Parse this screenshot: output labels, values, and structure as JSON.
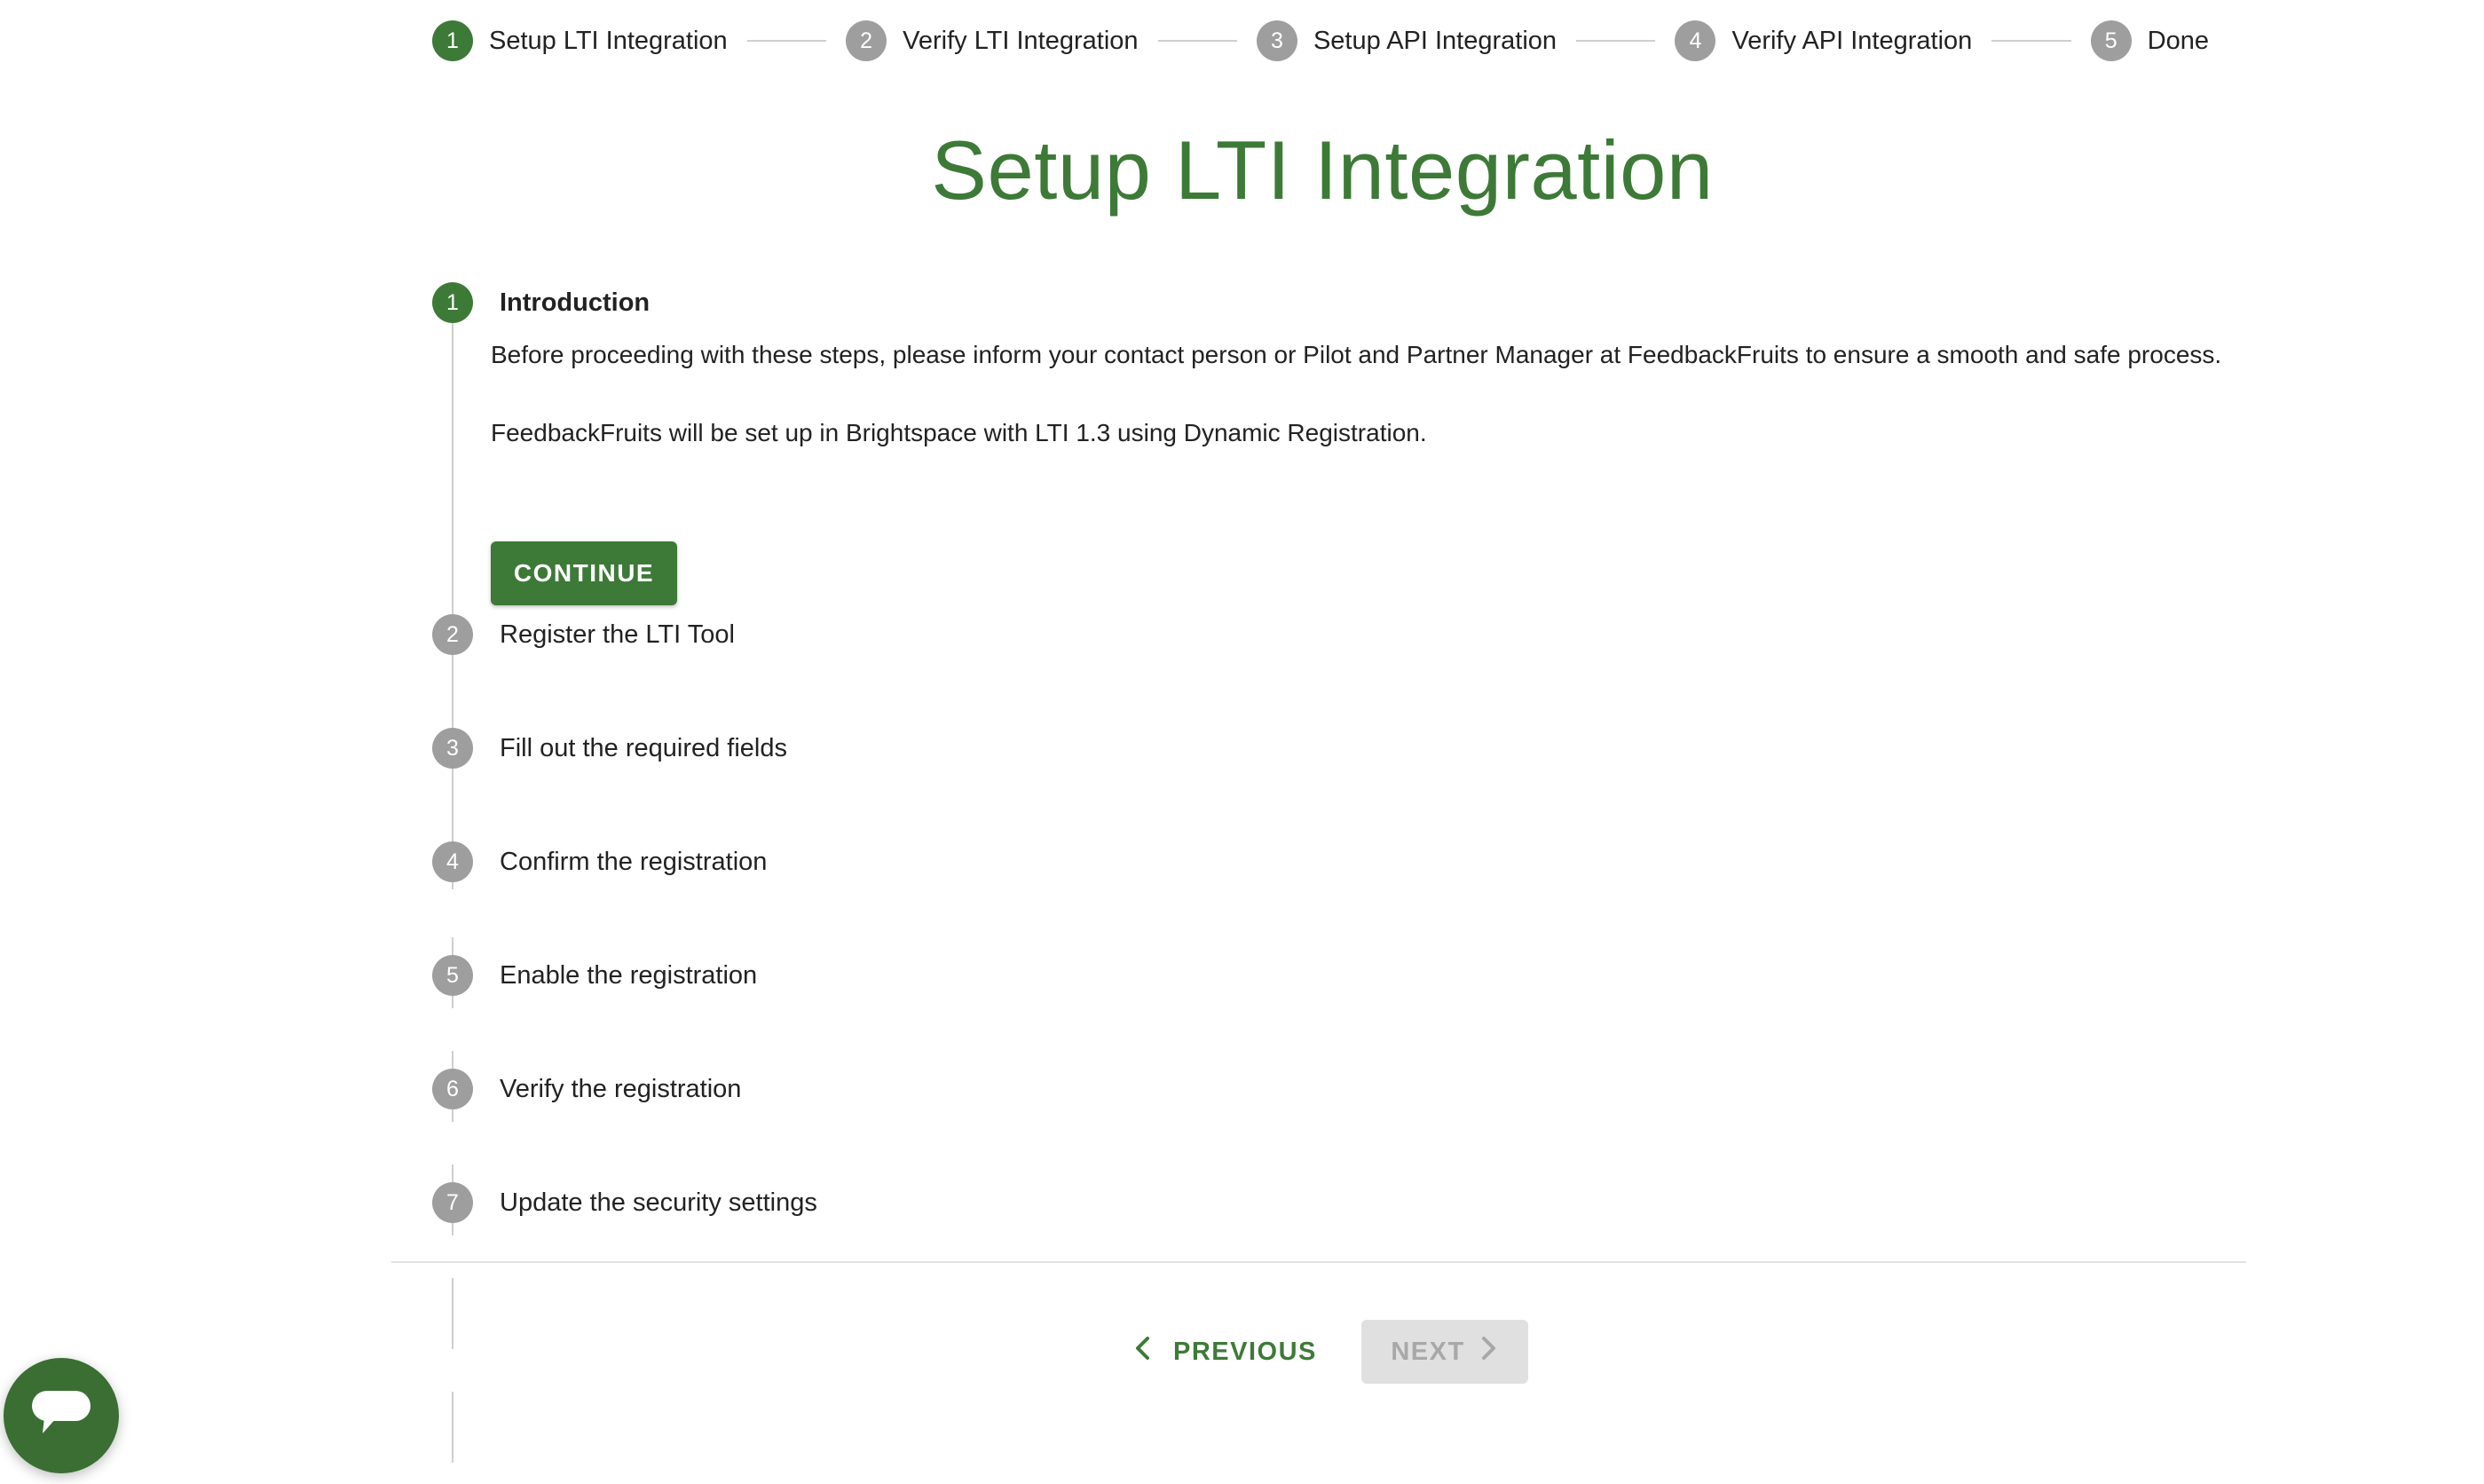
{
  "top_stepper": [
    {
      "num": "1",
      "label": "Setup LTI Integration",
      "active": true
    },
    {
      "num": "2",
      "label": "Verify LTI Integration",
      "active": false
    },
    {
      "num": "3",
      "label": "Setup API Integration",
      "active": false
    },
    {
      "num": "4",
      "label": "Verify API Integration",
      "active": false
    },
    {
      "num": "5",
      "label": "Done",
      "active": false
    }
  ],
  "page_title": "Setup LTI Integration",
  "steps": [
    {
      "num": "1",
      "label": "Introduction",
      "active": true
    },
    {
      "num": "2",
      "label": "Register the LTI Tool",
      "active": false
    },
    {
      "num": "3",
      "label": "Fill out the required fields",
      "active": false
    },
    {
      "num": "4",
      "label": "Confirm the registration",
      "active": false
    },
    {
      "num": "5",
      "label": "Enable the registration",
      "active": false
    },
    {
      "num": "6",
      "label": "Verify the registration",
      "active": false
    },
    {
      "num": "7",
      "label": "Update the security settings",
      "active": false
    }
  ],
  "intro": {
    "paragraph_1": "Before proceeding with these steps, please inform your contact person or Pilot and Partner Manager at FeedbackFruits to ensure a smooth and safe process.",
    "paragraph_2": "FeedbackFruits will be set up in Brightspace with LTI 1.3 using Dynamic Registration.",
    "continue_label": "CONTINUE"
  },
  "nav": {
    "previous_label": "PREVIOUS",
    "next_label": "NEXT",
    "next_disabled": true
  },
  "colors": {
    "accent": "#3d7a37",
    "inactive_step": "#9e9e9e",
    "disabled_bg": "#e0e0e0",
    "disabled_text": "#a8a8a8"
  },
  "icons": {
    "previous": "chevron-left-icon",
    "next": "chevron-right-icon",
    "chat": "chat-bubble-icon"
  }
}
